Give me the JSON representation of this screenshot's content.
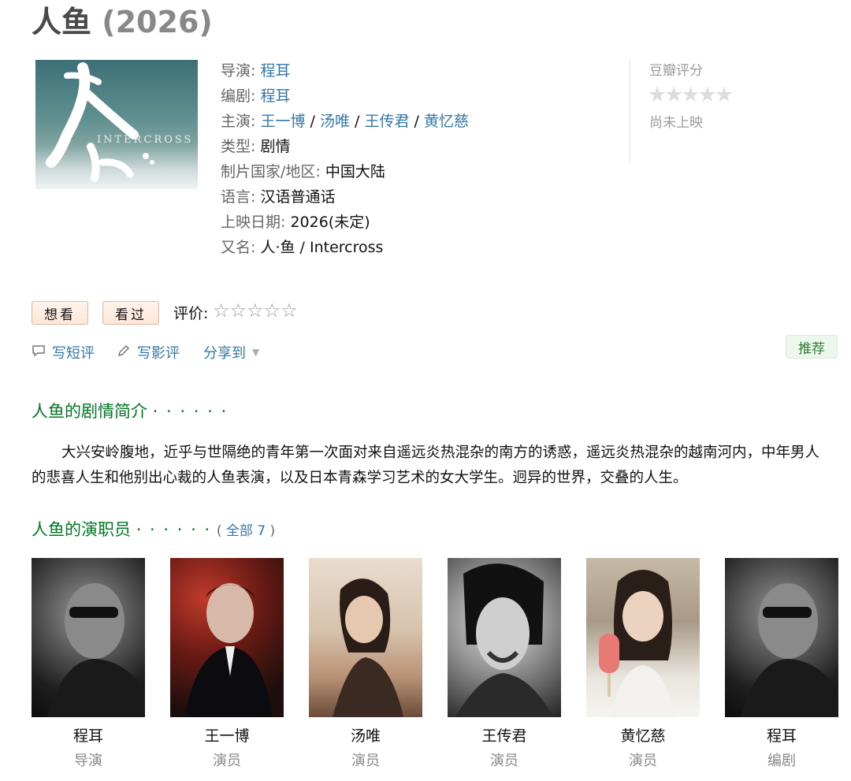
{
  "movie": {
    "title": "人鱼",
    "year": "(2026)",
    "poster": {
      "title_glyph": "人鱼",
      "subtitle": "INTERCROSS"
    }
  },
  "info": {
    "director": {
      "label": "导演: ",
      "names": [
        "程耳"
      ]
    },
    "writer": {
      "label": "编剧: ",
      "names": [
        "程耳"
      ]
    },
    "cast": {
      "label": "主演: ",
      "names": [
        "王一博",
        "汤唯",
        "王传君",
        "黄忆慈"
      ]
    },
    "genre": {
      "label": "类型: ",
      "value": "剧情"
    },
    "country": {
      "label": "制片国家/地区: ",
      "value": "中国大陆"
    },
    "language": {
      "label": "语言: ",
      "value": "汉语普通话"
    },
    "release": {
      "label": "上映日期: ",
      "value": "2026(未定)"
    },
    "aka": {
      "label": "又名: ",
      "value": "人·鱼 / Intercross"
    },
    "separator": " / "
  },
  "rating": {
    "label": "豆瓣评分",
    "stars": "★★★★★",
    "status": "尚未上映"
  },
  "actions": {
    "want": "想看",
    "watched": "看过",
    "rate_label": "评价: ",
    "rate_stars": "☆☆☆☆☆",
    "write_short": "写短评",
    "write_review": "写影评",
    "share": "分享到",
    "recommend": "推荐"
  },
  "icons": {
    "comment": "comment-icon",
    "pencil": "pencil-icon",
    "caret": "chevron-down-icon"
  },
  "summary": {
    "heading": "人鱼的剧情简介",
    "dots": "· · · · · ·",
    "text": "大兴安岭腹地，近乎与世隔绝的青年第一次面对来自遥远炎热混杂的南方的诱惑，遥远炎热混杂的越南河内，中年男人的悲喜人生和他别出心裁的人鱼表演，以及日本青森学习艺术的女大学生。迥异的世界，交叠的人生。"
  },
  "cast_section": {
    "heading": "人鱼的演职员",
    "dots": "· · · · · ·",
    "all_open": "( ",
    "all_link": "全部 7",
    "all_close": " )",
    "members": [
      {
        "name": "程耳",
        "role": "导演"
      },
      {
        "name": "王一博",
        "role": "演员"
      },
      {
        "name": "汤唯",
        "role": "演员"
      },
      {
        "name": "王传君",
        "role": "演员"
      },
      {
        "name": "黄忆慈",
        "role": "演员"
      },
      {
        "name": "程耳",
        "role": "编剧"
      }
    ]
  },
  "colors": {
    "link": "#3377aa",
    "section_heading": "#007722",
    "button_bg": "#fde6d8",
    "recommend_bg": "#eef7ee"
  }
}
